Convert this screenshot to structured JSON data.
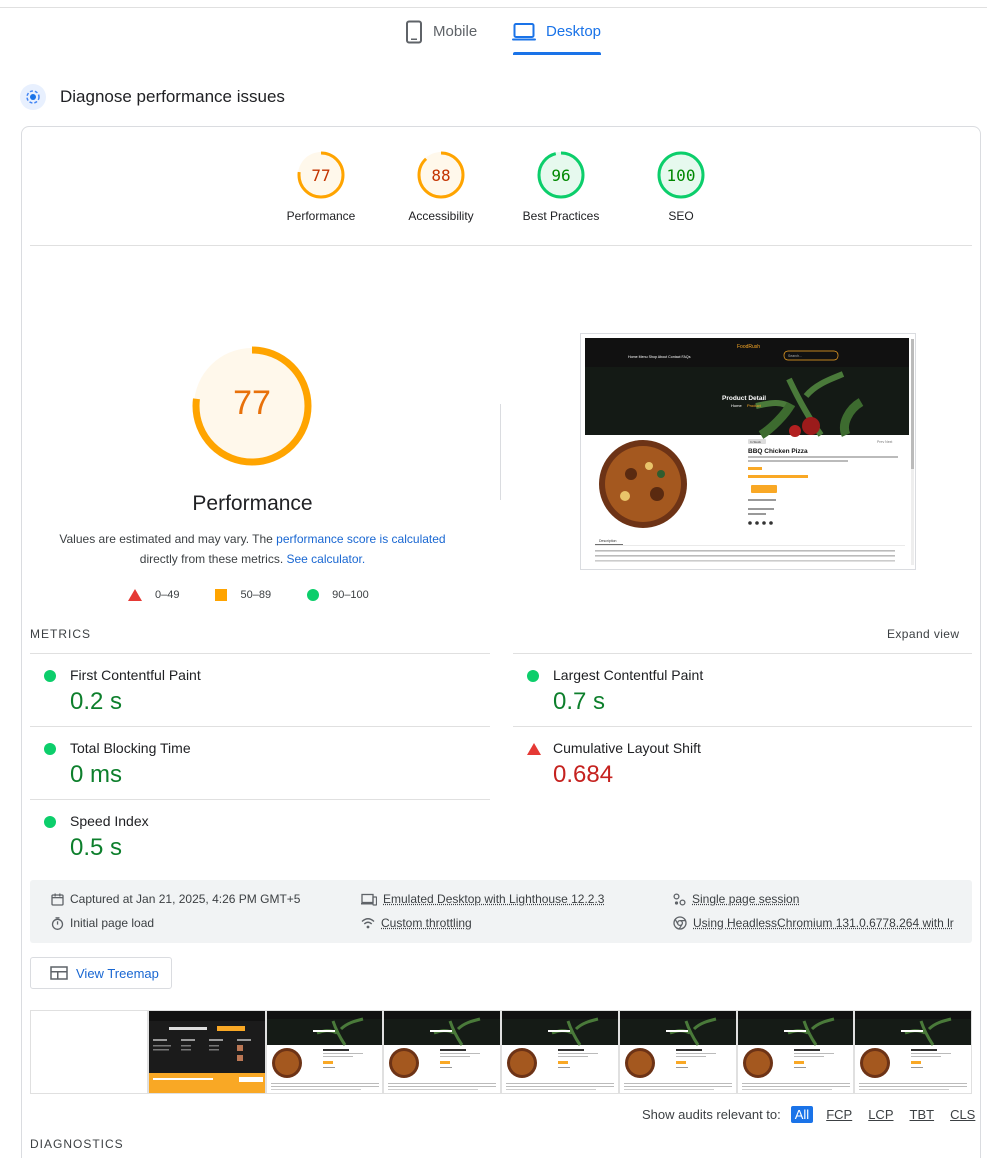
{
  "tabs": [
    {
      "label": "Mobile",
      "icon": "mobile-icon",
      "active": false
    },
    {
      "label": "Desktop",
      "icon": "laptop-icon",
      "active": true
    }
  ],
  "diagnose": {
    "title": "Diagnose performance issues",
    "icon": "diagnose-icon"
  },
  "scores": [
    {
      "value": "77",
      "label": "Performance",
      "status": "average",
      "fraction": 0.77
    },
    {
      "value": "88",
      "label": "Accessibility",
      "status": "average",
      "fraction": 0.88
    },
    {
      "value": "96",
      "label": "Best Practices",
      "status": "pass",
      "fraction": 0.96
    },
    {
      "value": "100",
      "label": "SEO",
      "status": "pass",
      "fraction": 1.0
    }
  ],
  "performance": {
    "score": "77",
    "fraction": 0.77,
    "title": "Performance",
    "note_1": "Values are estimated and may vary. The ",
    "note_link_1": "performance score is calculated",
    "note_2": "directly from these metrics. ",
    "note_link_2": "See calculator.",
    "legend": [
      {
        "range": "0–49",
        "shape": "triangle",
        "color": "#e53935"
      },
      {
        "range": "50–89",
        "shape": "square",
        "color": "#ffa400"
      },
      {
        "range": "90–100",
        "shape": "circle",
        "color": "#0cce6b"
      }
    ]
  },
  "screenshot": {
    "brand": "FoodRush",
    "nav": [
      "Home",
      "Menu",
      "Shop",
      "About",
      "Contact",
      "FAQs"
    ],
    "search_placeholder": "Search...",
    "hero_title": "Product Detail",
    "hero_crumb_home": "Home",
    "hero_crumb_current": "Product",
    "badge": "In Stock",
    "product_name": "BBQ Chicken Pizza",
    "tab_label": "Description",
    "prev_next": "Prev  Next"
  },
  "metrics": {
    "header": "METRICS",
    "expand_label": "Expand view",
    "items": [
      {
        "name": "First Contentful Paint",
        "value": "0.2 s",
        "status": "good"
      },
      {
        "name": "Largest Contentful Paint",
        "value": "0.7 s",
        "status": "good"
      },
      {
        "name": "Total Blocking Time",
        "value": "0 ms",
        "status": "good"
      },
      {
        "name": "Cumulative Layout Shift",
        "value": "0.684",
        "status": "bad"
      },
      {
        "name": "Speed Index",
        "value": "0.5 s",
        "status": "good"
      }
    ]
  },
  "info": {
    "captured": "Captured at Jan 21, 2025, 4:26 PM GMT+5",
    "initial_load": "Initial page load",
    "emulated": "Emulated Desktop with Lighthouse 12.2.3",
    "throttling": "Custom throttling",
    "session": "Single page session",
    "browser": "Using HeadlessChromium 131.0.6778.264 with lr"
  },
  "treemap": {
    "label": "View Treemap",
    "icon": "treemap-icon"
  },
  "audits_filter": {
    "label": "Show audits relevant to:",
    "options": [
      "All",
      "FCP",
      "LCP",
      "TBT",
      "CLS"
    ],
    "selected": "All"
  },
  "diagnostics_header": "DIAGNOSTICS",
  "colors": {
    "accent": "#1a73e8",
    "average": "#ffa400",
    "pass": "#0cce6b",
    "fail": "#e53935"
  }
}
